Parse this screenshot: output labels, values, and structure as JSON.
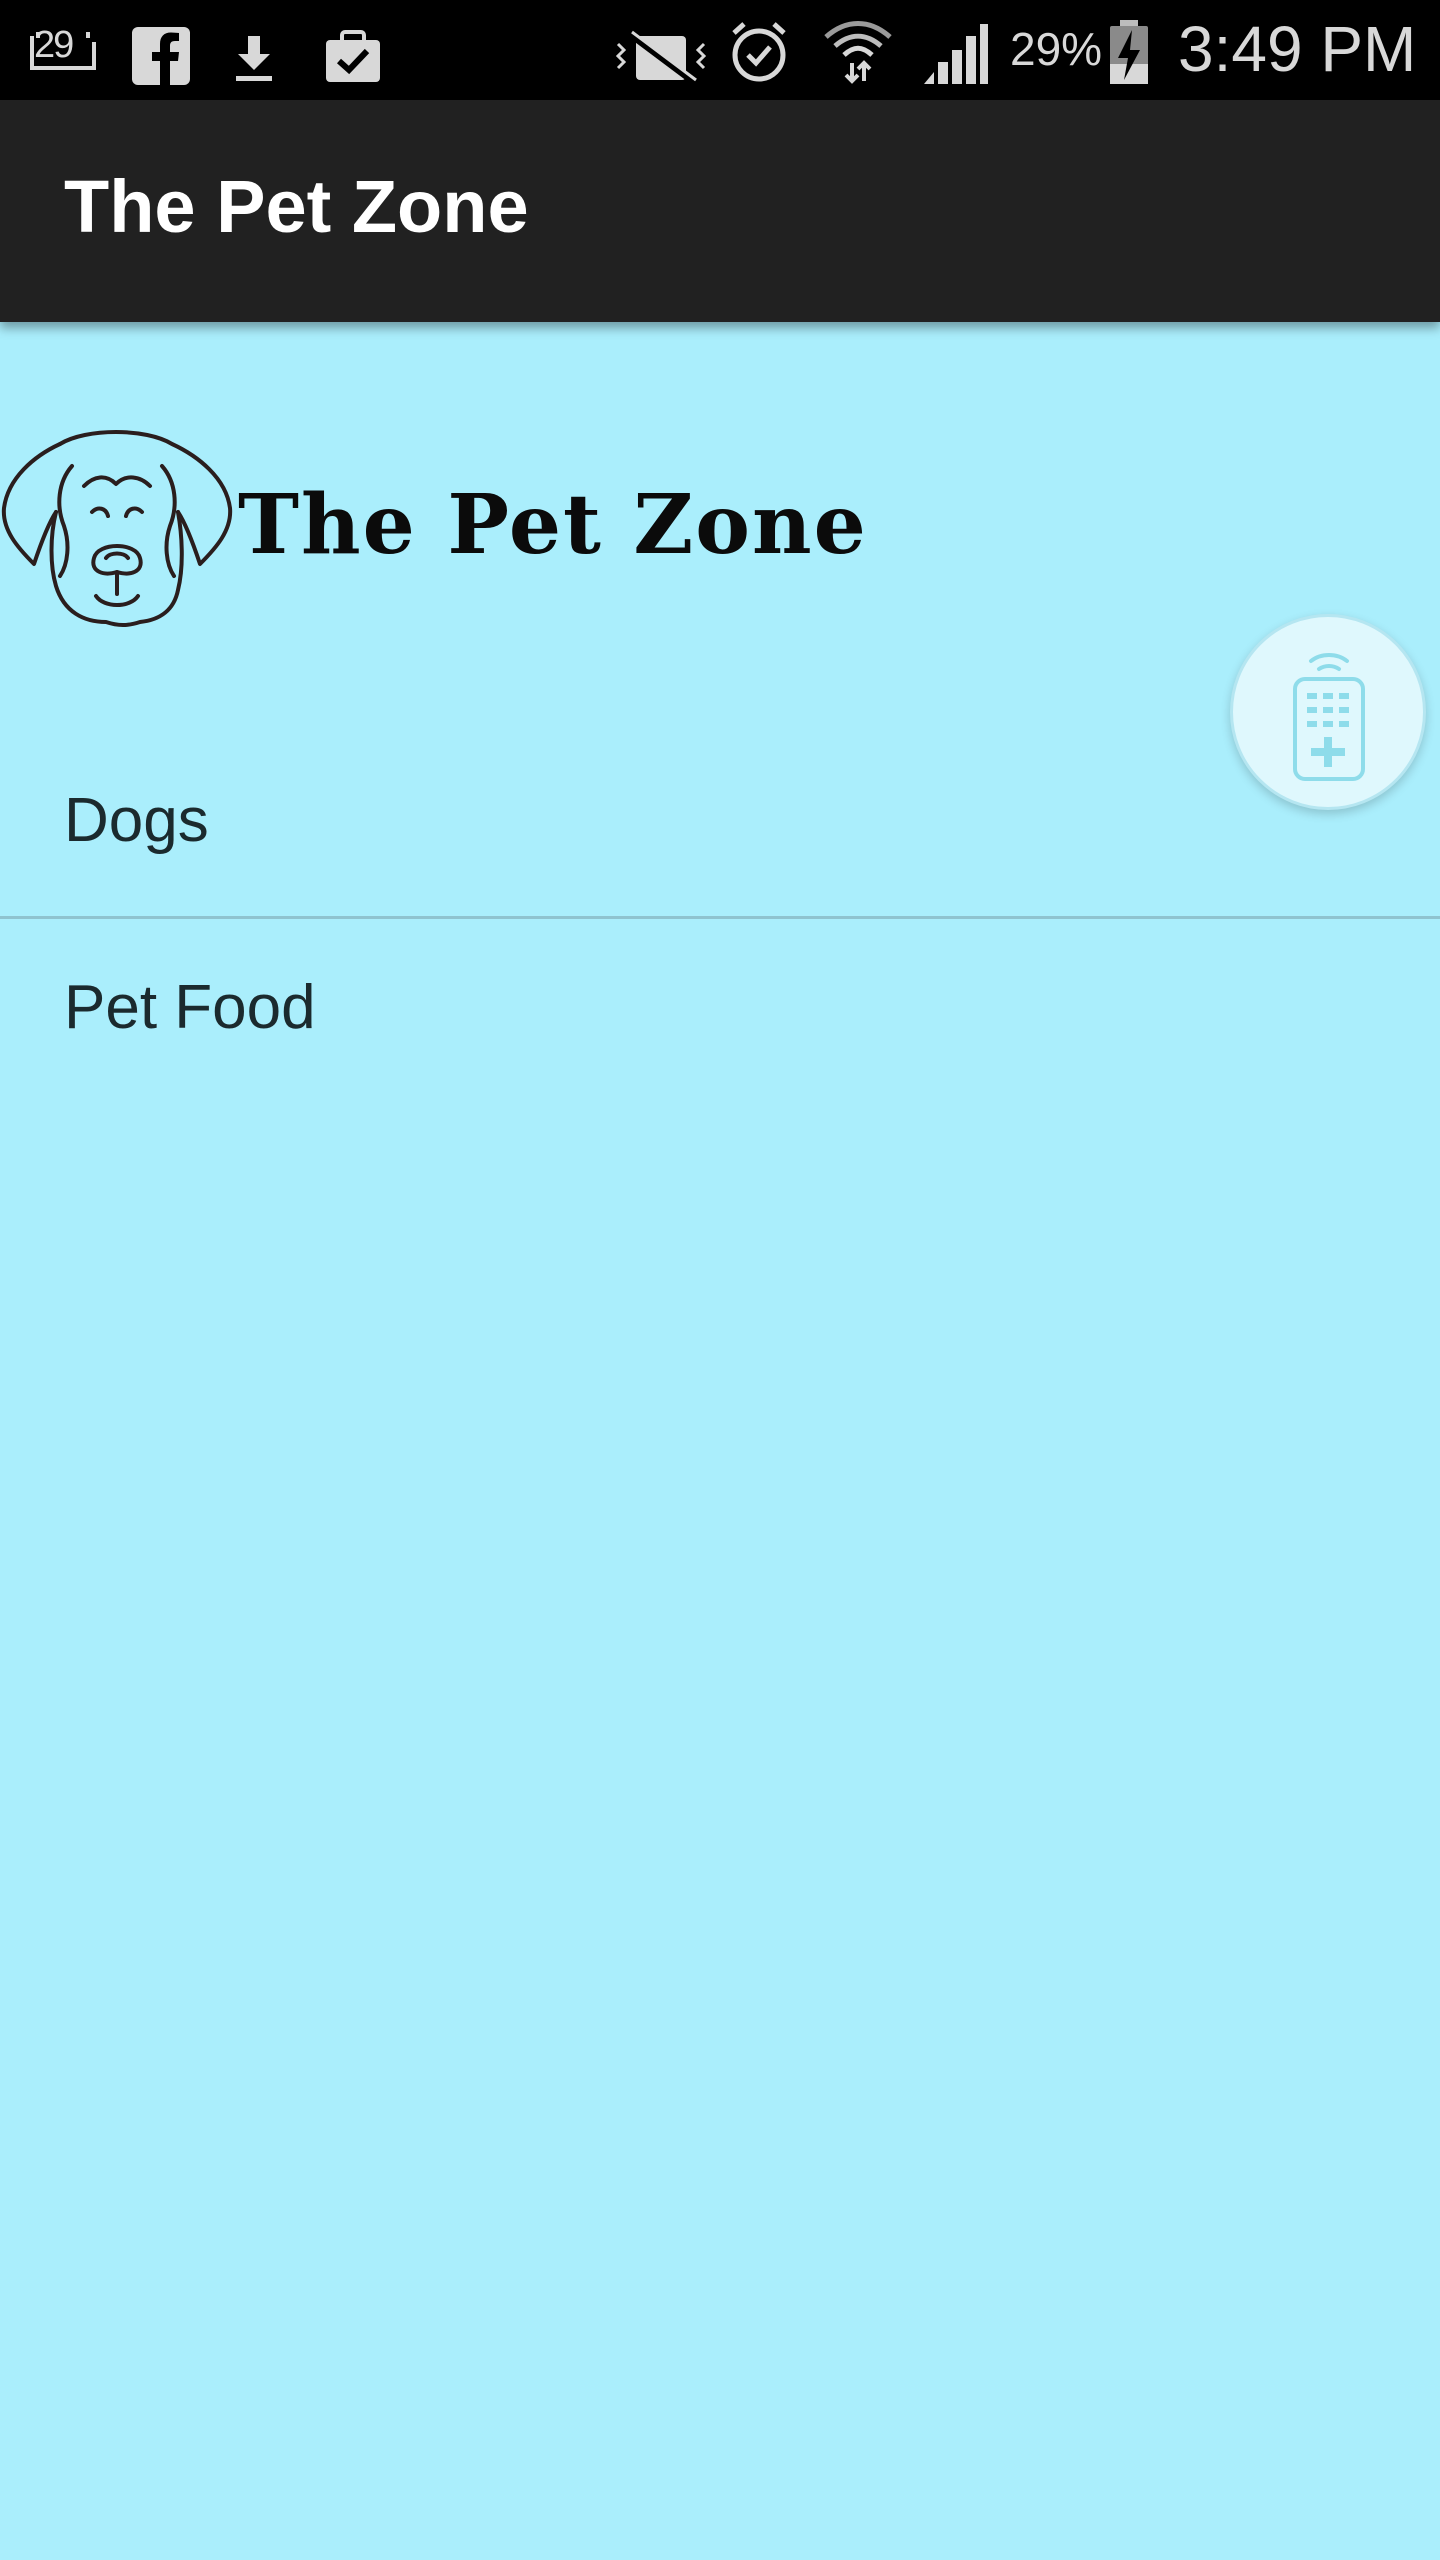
{
  "status_bar": {
    "notification_count": "29",
    "battery_percent": "29%",
    "time": "3:49 PM",
    "icons": [
      "calendar-badge-icon",
      "facebook-icon",
      "download-icon",
      "clipboard-check-icon",
      "vibrate-icon",
      "alarm-icon",
      "wifi-icon",
      "signal-icon",
      "battery-charging-icon"
    ]
  },
  "action_bar": {
    "title": "The Pet Zone",
    "background": "#212121"
  },
  "logo": {
    "text": "The Pet Zone",
    "icon": "dog-head-icon"
  },
  "menu": {
    "items": [
      {
        "label": "Dogs"
      },
      {
        "label": "Pet Food"
      }
    ]
  },
  "fab": {
    "icon": "remote-control-icon"
  },
  "colors": {
    "page_background": "#aaeefc",
    "divider": "#8fc3cf",
    "text": "#1b2a2e"
  }
}
